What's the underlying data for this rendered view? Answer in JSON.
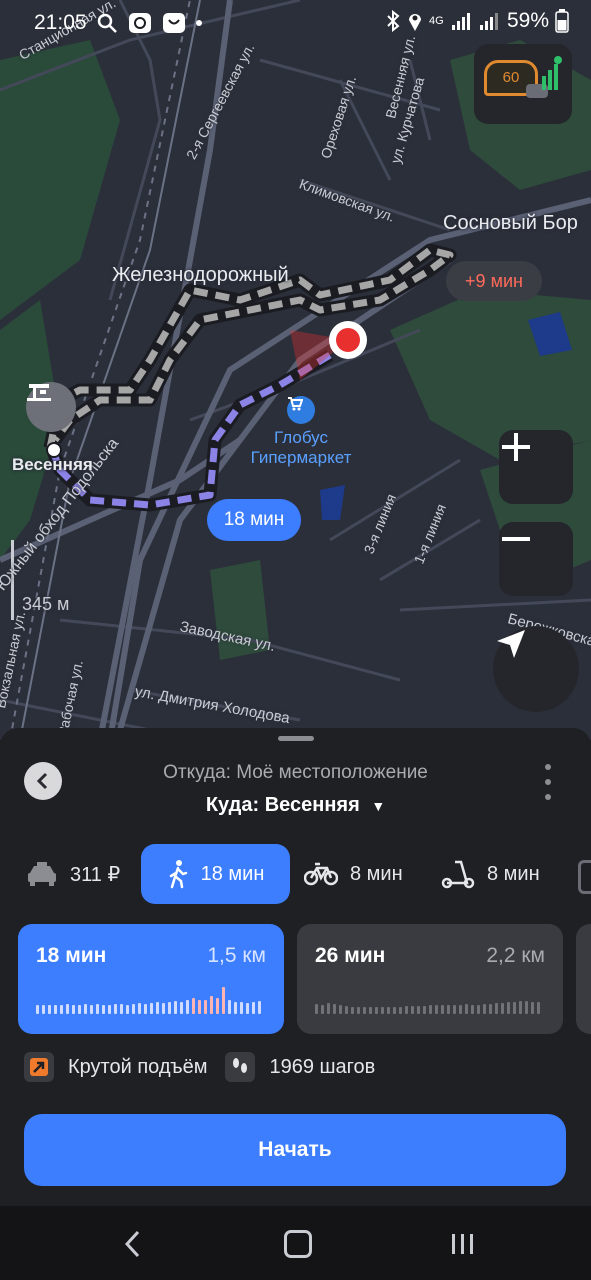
{
  "status_bar": {
    "time": "21:05",
    "network": "4G",
    "battery": "59%"
  },
  "map": {
    "labels": {
      "district_1": "Железнодорожный",
      "district_2": "Сосновый Бор",
      "poi_name_1": "Глобус",
      "poi_name_2": "Гипермаркет",
      "stop_name": "Весенняя",
      "scale": "345 м"
    },
    "streets": [
      "Станционная ул.",
      "2-я Сергеевская ул.",
      "Ореховая ул.",
      "Весенняя ул.",
      "ул. Курчатова",
      "Климовская ул.",
      "Южный обход Подольска",
      "Заводская ул.",
      "ул. Дмитрия Холодова",
      "3-я линия",
      "1-я линия",
      "Бережковская",
      "Вокзальная ул.",
      "Рабочая ул."
    ],
    "alt_route_badge": "+9 мин",
    "route_badge": "18 мин",
    "speed_limit": "60"
  },
  "sheet": {
    "from_label": "Откуда: Моё местоположение",
    "to_label": "Куда: Весенняя",
    "modes": [
      {
        "icon": "taxi-icon",
        "label": "311 ₽"
      },
      {
        "icon": "walk-icon",
        "label": "18 мин",
        "selected": true
      },
      {
        "icon": "bike-icon",
        "label": "8 мин"
      },
      {
        "icon": "scooter-icon",
        "label": "8 мин"
      }
    ],
    "routes": [
      {
        "time": "18 мин",
        "distance": "1,5 км",
        "selected": true
      },
      {
        "time": "26 мин",
        "distance": "2,2 км",
        "selected": false
      }
    ],
    "info": {
      "climb": "Крутой подъём",
      "steps": "1969 шагов"
    },
    "start_button": "Начать"
  },
  "colors": {
    "accent": "#3d7eff",
    "route_walk": "#8b83e6",
    "alt_route": "#a6a6a6",
    "destination": "#e8312f",
    "alt_badge_text": "#ff6b5b"
  }
}
